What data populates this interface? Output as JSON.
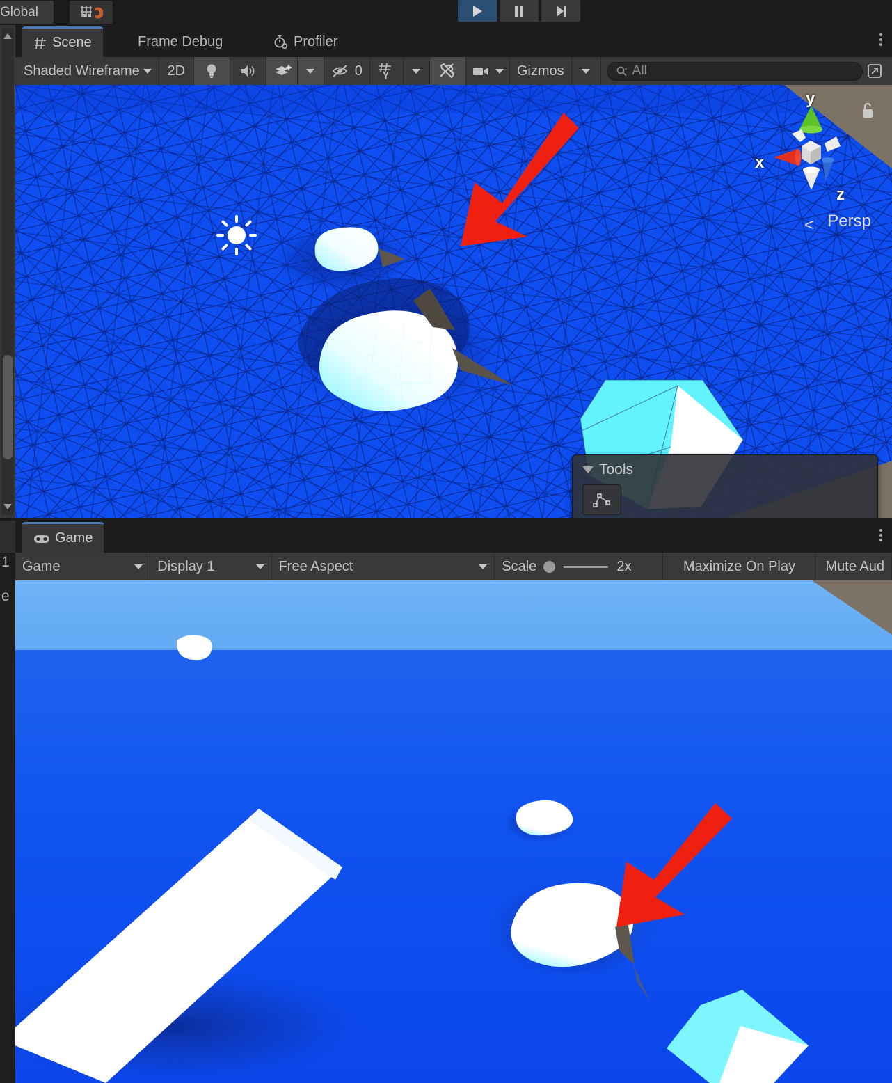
{
  "main_toolbar": {
    "pivot_rotation_label": "Global",
    "snap_icon": "magnet-snap-icon",
    "play_icon": "play-icon",
    "pause_icon": "pause-icon",
    "step_icon": "step-icon"
  },
  "scene_panel": {
    "tabs": [
      {
        "label": "Scene",
        "icon": "scene-grid-icon",
        "active": true
      },
      {
        "label": "Frame Debug",
        "icon": "",
        "active": false
      },
      {
        "label": "Profiler",
        "icon": "stopwatch-icon",
        "active": false
      }
    ],
    "overflow_icon": "kebab-menu-icon",
    "toolbar": {
      "draw_mode": "Shaded Wireframe",
      "mode_2d": "2D",
      "lighting_icon": "lightbulb-icon",
      "audio_icon": "speaker-icon",
      "effects_icon": "fx-layers-icon",
      "hidden_count": "0",
      "hidden_icon": "eye-off-icon",
      "grid_icon": "grid-axis-icon",
      "tools_icon": "tools-icon",
      "camera_icon": "camera-icon",
      "gizmos_label": "Gizmos",
      "search_placeholder": "All",
      "search_value": "",
      "search_icon": "search-icon",
      "expand_icon": "open-window-icon"
    },
    "gizmo": {
      "axis_x": "x",
      "axis_y": "y",
      "axis_z": "z",
      "projection_label": "Persp",
      "lock_icon": "unlock-icon",
      "color_x": "#e03020",
      "color_y": "#5dc22a",
      "color_z": "#2f6ad0"
    },
    "overlay": {
      "title": "Tools",
      "collapse_icon": "triangle-down-icon",
      "tool_icon": "custom-editor-tool-icon"
    },
    "light_gizmo_icon": "directional-light-sun-icon",
    "annotation_icon": "red-arrow-annotation"
  },
  "game_panel": {
    "tabs": [
      {
        "label": "Game",
        "icon": "gamepad-icon",
        "active": true
      }
    ],
    "overflow_icon": "kebab-menu-icon",
    "toolbar": {
      "view_mode": "Game",
      "display": "Display 1",
      "aspect": "Free Aspect",
      "scale_label": "Scale",
      "scale_value": "2x",
      "maximize_on_play": "Maximize On Play",
      "mute_audio": "Mute Aud"
    },
    "annotation_icon": "red-arrow-annotation"
  },
  "left_edge": {
    "scroll_up_icon": "scroll-up-arrow",
    "scroll_down_icon": "scroll-down-arrow",
    "fragment_1": "1",
    "fragment_e": "e"
  },
  "colors": {
    "water_blue": "#0e4df0",
    "wire_dark": "#0a1a5a",
    "ice_white": "#ffffff",
    "ice_cyan": "#62f3ff",
    "terrain_tan": "#7d7266",
    "annotation_red": "#f02010",
    "accent_tab": "#4a7ab5",
    "panel_bg": "#383838",
    "toolbar_bg": "#393939",
    "window_bg": "#1b1b1b",
    "sky_top": "#6fb4f5",
    "sky_bottom": "#1f62ee"
  }
}
